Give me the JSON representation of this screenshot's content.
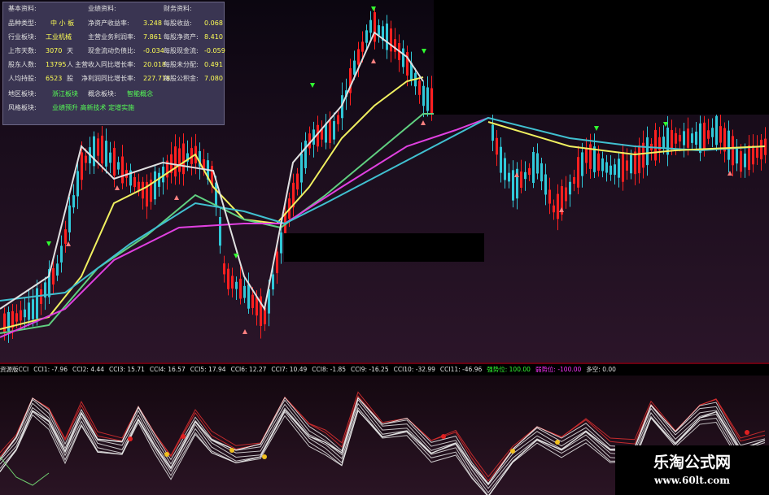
{
  "info_panel": {
    "headers": [
      "基本资料:",
      "业绩资料:",
      "财务资料:"
    ],
    "rows": [
      [
        {
          "t": "品种类型:",
          "c": "lab"
        },
        {
          "t": "中 小 板",
          "c": "val"
        },
        {
          "t": "净资产收益率:",
          "c": "lab"
        },
        {
          "t": "3.248",
          "c": "val"
        },
        {
          "t": "每股收益:",
          "c": "lab"
        },
        {
          "t": "0.068",
          "c": "val"
        }
      ],
      [
        {
          "t": "行业板块:",
          "c": "lab"
        },
        {
          "t": "工业机械",
          "c": "val"
        },
        {
          "t": "主营业务利润率:",
          "c": "lab"
        },
        {
          "t": "7.861",
          "c": "val"
        },
        {
          "t": "每股净资产:",
          "c": "lab"
        },
        {
          "t": "8.410",
          "c": "val"
        }
      ],
      [
        {
          "t": "上市天数:",
          "c": "lab"
        },
        {
          "t": "3070",
          "c": "val"
        },
        {
          "t": "天",
          "c": "lab"
        },
        {
          "t": "现金流动负债比:",
          "c": "lab"
        },
        {
          "t": "-0.034",
          "c": "val"
        },
        {
          "t": "每股现金流:",
          "c": "lab"
        },
        {
          "t": "-0.059",
          "c": "val"
        }
      ],
      [
        {
          "t": "股东人数:",
          "c": "lab"
        },
        {
          "t": "13795",
          "c": "val"
        },
        {
          "t": "人",
          "c": "lab"
        },
        {
          "t": "主营收入同比增长率:",
          "c": "lab"
        },
        {
          "t": "20.018",
          "c": "val"
        },
        {
          "t": "每股未分配:",
          "c": "lab"
        },
        {
          "t": "0.491",
          "c": "val"
        }
      ],
      [
        {
          "t": "人均持股:",
          "c": "lab"
        },
        {
          "t": "6523",
          "c": "val"
        },
        {
          "t": "股",
          "c": "lab"
        },
        {
          "t": "净利润同比增长率:",
          "c": "lab"
        },
        {
          "t": "227.718",
          "c": "val"
        },
        {
          "t": "每股公积金:",
          "c": "lab"
        },
        {
          "t": "7.080",
          "c": "val"
        }
      ],
      [
        {
          "t": "地区板块:",
          "c": "lab"
        },
        {
          "t": "浙江板块",
          "c": "grn"
        },
        {
          "t": "概念板块:",
          "c": "lab"
        },
        {
          "t": "智能概念",
          "c": "grn"
        }
      ],
      [
        {
          "t": "风格板块:",
          "c": "lab"
        },
        {
          "t": "业绩预升 高新技术 定增实施",
          "c": "grn"
        }
      ]
    ]
  },
  "cci_bar": {
    "items": [
      {
        "text": "资源版CCI",
        "color": "#e0e0e0"
      },
      {
        "text": "CCI1: -7.96",
        "color": "#e0e0e0"
      },
      {
        "text": "CCI2: 4.44",
        "color": "#e0e0e0"
      },
      {
        "text": "CCI3: 15.71",
        "color": "#e0e0e0"
      },
      {
        "text": "CCI4: 16.57",
        "color": "#e0e0e0"
      },
      {
        "text": "CCI5: 17.94",
        "color": "#e0e0e0"
      },
      {
        "text": "CCI6: 12.27",
        "color": "#e0e0e0"
      },
      {
        "text": "CCI7: 10.49",
        "color": "#e0e0e0"
      },
      {
        "text": "CCI8: -1.85",
        "color": "#e0e0e0"
      },
      {
        "text": "CCI9: -16.25",
        "color": "#e0e0e0"
      },
      {
        "text": "CCI10: -32.99",
        "color": "#e0e0e0"
      },
      {
        "text": "CCI11: -46.96",
        "color": "#e0e0e0"
      },
      {
        "text": "强势位: 100.00",
        "color": "#33ff33"
      },
      {
        "text": "弱势位: -100.00",
        "color": "#ff33ff"
      },
      {
        "text": "多空: 0.00",
        "color": "#e0e0e0"
      }
    ]
  },
  "watermark": {
    "title": "乐淘公式网",
    "url": "www.60lt.com"
  },
  "colors": {
    "up": "#ff2020",
    "down": "#30c8d8",
    "ma_white": "#e0e0e0",
    "ma_yellow": "#f0f060",
    "ma_green": "#60d080",
    "ma_magenta": "#e040e0",
    "ma_cyan": "#40c0d0",
    "buy_arrow": "#30ff30",
    "sell_arrow": "#ff8080"
  }
}
